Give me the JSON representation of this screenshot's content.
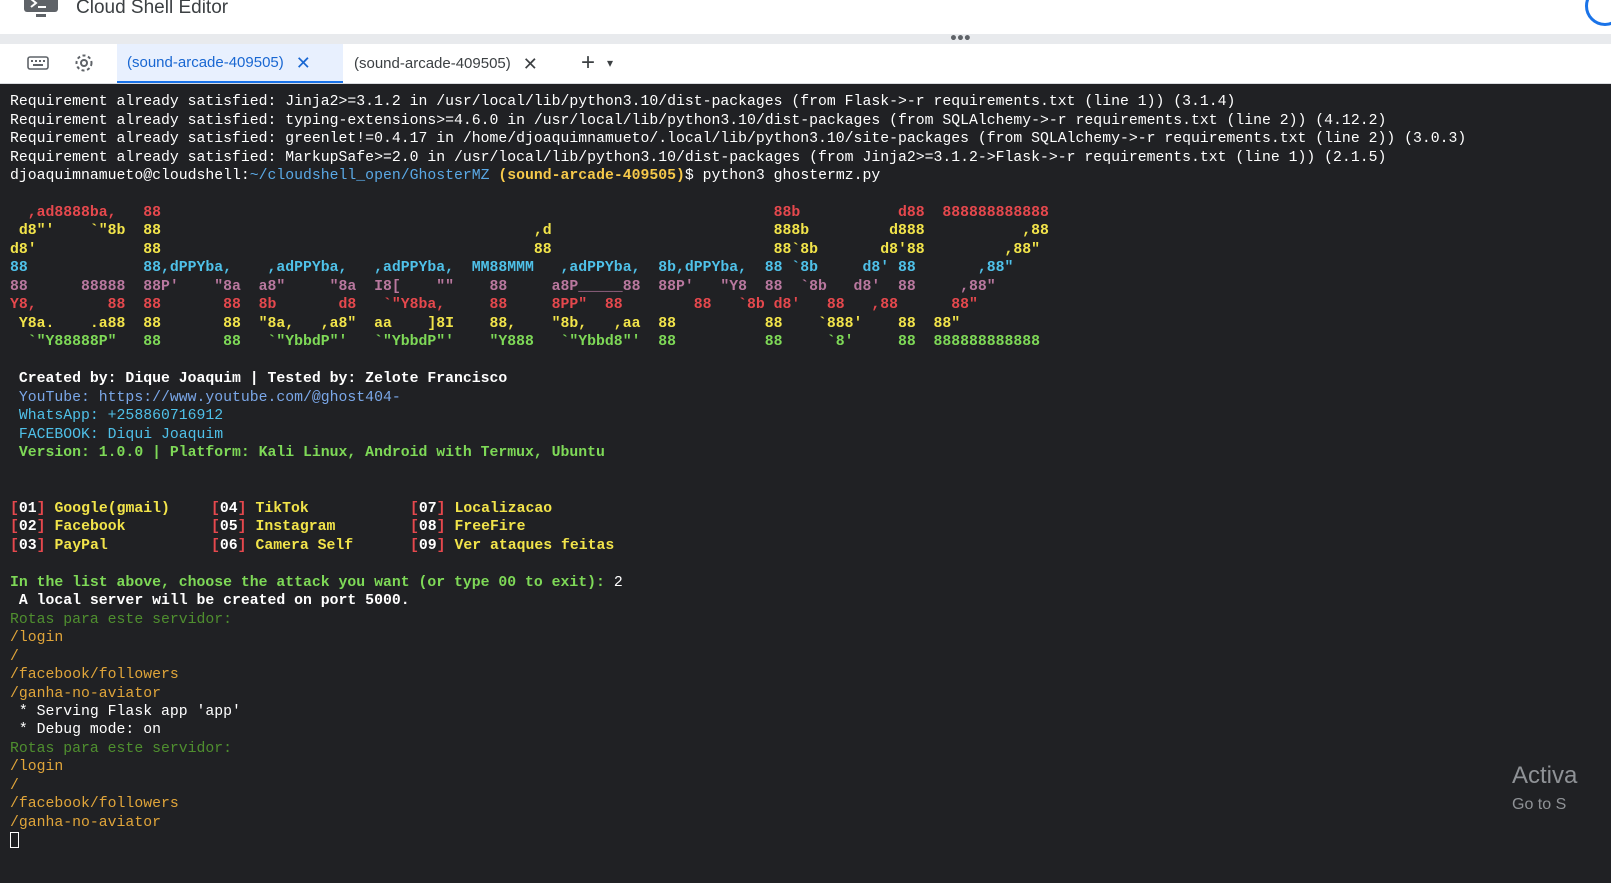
{
  "window": {
    "title": "Cloud Shell Editor"
  },
  "tabs": [
    {
      "label": "(sound-arcade-409505)",
      "active": true
    },
    {
      "label": "(sound-arcade-409505)",
      "active": false
    }
  ],
  "toolbar": {
    "add_tab": "+",
    "dropdown": "▾",
    "drag_handle": "•••"
  },
  "terminal": {
    "pip_lines": [
      "Requirement already satisfied: Jinja2>=3.1.2 in /usr/local/lib/python3.10/dist-packages (from Flask->-r requirements.txt (line 1)) (3.1.4)",
      "Requirement already satisfied: typing-extensions>=4.6.0 in /usr/local/lib/python3.10/dist-packages (from SQLAlchemy->-r requirements.txt (line 2)) (4.12.2)",
      "Requirement already satisfied: greenlet!=0.4.17 in /home/djoaquimnamueto/.local/lib/python3.10/site-packages (from SQLAlchemy->-r requirements.txt (line 2)) (3.0.3)",
      "Requirement already satisfied: MarkupSafe>=2.0 in /usr/local/lib/python3.10/dist-packages (from Jinja2>=3.1.2->Flask->-r requirements.txt (line 1)) (2.1.5)"
    ],
    "prompt": {
      "user": "djoaquimnamueto@cloudshell:",
      "path": "~/cloudshell_open/GhosterMZ",
      "project": "(sound-arcade-409505)",
      "symbol": "$ ",
      "command": "python3 ghostermz.py"
    },
    "banner": [
      {
        "text": "  ,ad8888ba,   88                                                                     88b           d88  888888888888",
        "color": "#e5484d"
      },
      {
        "text": " d8\"'    `\"8b  88                                          ,d                         888b         d888           ,88",
        "color": "#f2e44a"
      },
      {
        "text": "d8'            88                                          88                         88`8b       d8'88         ,88\"",
        "color": "#f2e44a"
      },
      {
        "text": "88             88,dPPYba,    ,adPPYba,   ,adPPYba,  MM88MMM   ,adPPYba,  8b,dPPYba,  88 `8b     d8' 88       ,88\"",
        "color": "#4fc1e9"
      },
      {
        "text": "88      88888  88P'    \"8a  a8\"     \"8a  I8[    \"\"    88     a8P_____88  88P'   \"Y8  88  `8b   d8'  88     ,88\"",
        "color": "#b9789f"
      },
      {
        "text": "Y8,        88  88       88  8b       d8   `\"Y8ba,     88     8PP\"  88        88   `8b d8'   88   ,88      88\"",
        "color": "#e5484d"
      },
      {
        "text": " Y8a.    .a88  88       88  \"8a,   ,a8\"  aa    ]8I    88,    \"8b,   ,aa  88          88    `888'    88  88\"",
        "color": "#f2e44a"
      },
      {
        "text": "  `\"Y88888P\"   88       88   `\"YbbdP\"'   `\"YbbdP\"'    \"Y888   `\"Ybbd8\"'  88          88     `8'     88  888888888888",
        "color": "#7ed957"
      }
    ],
    "credits": " Created by: Dique Joaquim | Tested by: Zelote Francisco",
    "youtube": " YouTube: https://www.youtube.com/@ghost404-",
    "whatsapp": " WhatsApp: +258860716912",
    "facebook": " FACEBOOK: Diqui Joaquim",
    "version": " Version: 1.0.0 | Platform: Kali Linux, Android with Termux, Ubuntu",
    "menu": [
      [
        {
          "num": "01",
          "label": "Google(gmail)"
        },
        {
          "num": "04",
          "label": "TikTok"
        },
        {
          "num": "07",
          "label": "Localizacao"
        }
      ],
      [
        {
          "num": "02",
          "label": "Facebook"
        },
        {
          "num": "05",
          "label": "Instagram"
        },
        {
          "num": "08",
          "label": "FreeFire"
        }
      ],
      [
        {
          "num": "03",
          "label": "PayPal"
        },
        {
          "num": "06",
          "label": "Camera Self"
        },
        {
          "num": "09",
          "label": "Ver ataques feitas"
        }
      ]
    ],
    "choose_prompt": "In the list above, choose the attack you want (or type 00 to exit): ",
    "choose_value": "2",
    "server_msg": " A local server will be created on port 5000.",
    "routes_header": "Rotas para este servidor:",
    "routes": [
      "/login",
      "/",
      "/facebook/followers",
      "/ganha-no-aviator"
    ],
    "serving": " * Serving Flask app 'app'",
    "debug": " * Debug mode: on"
  },
  "watermark": {
    "title": "Activa",
    "subtitle": "Go to S"
  }
}
